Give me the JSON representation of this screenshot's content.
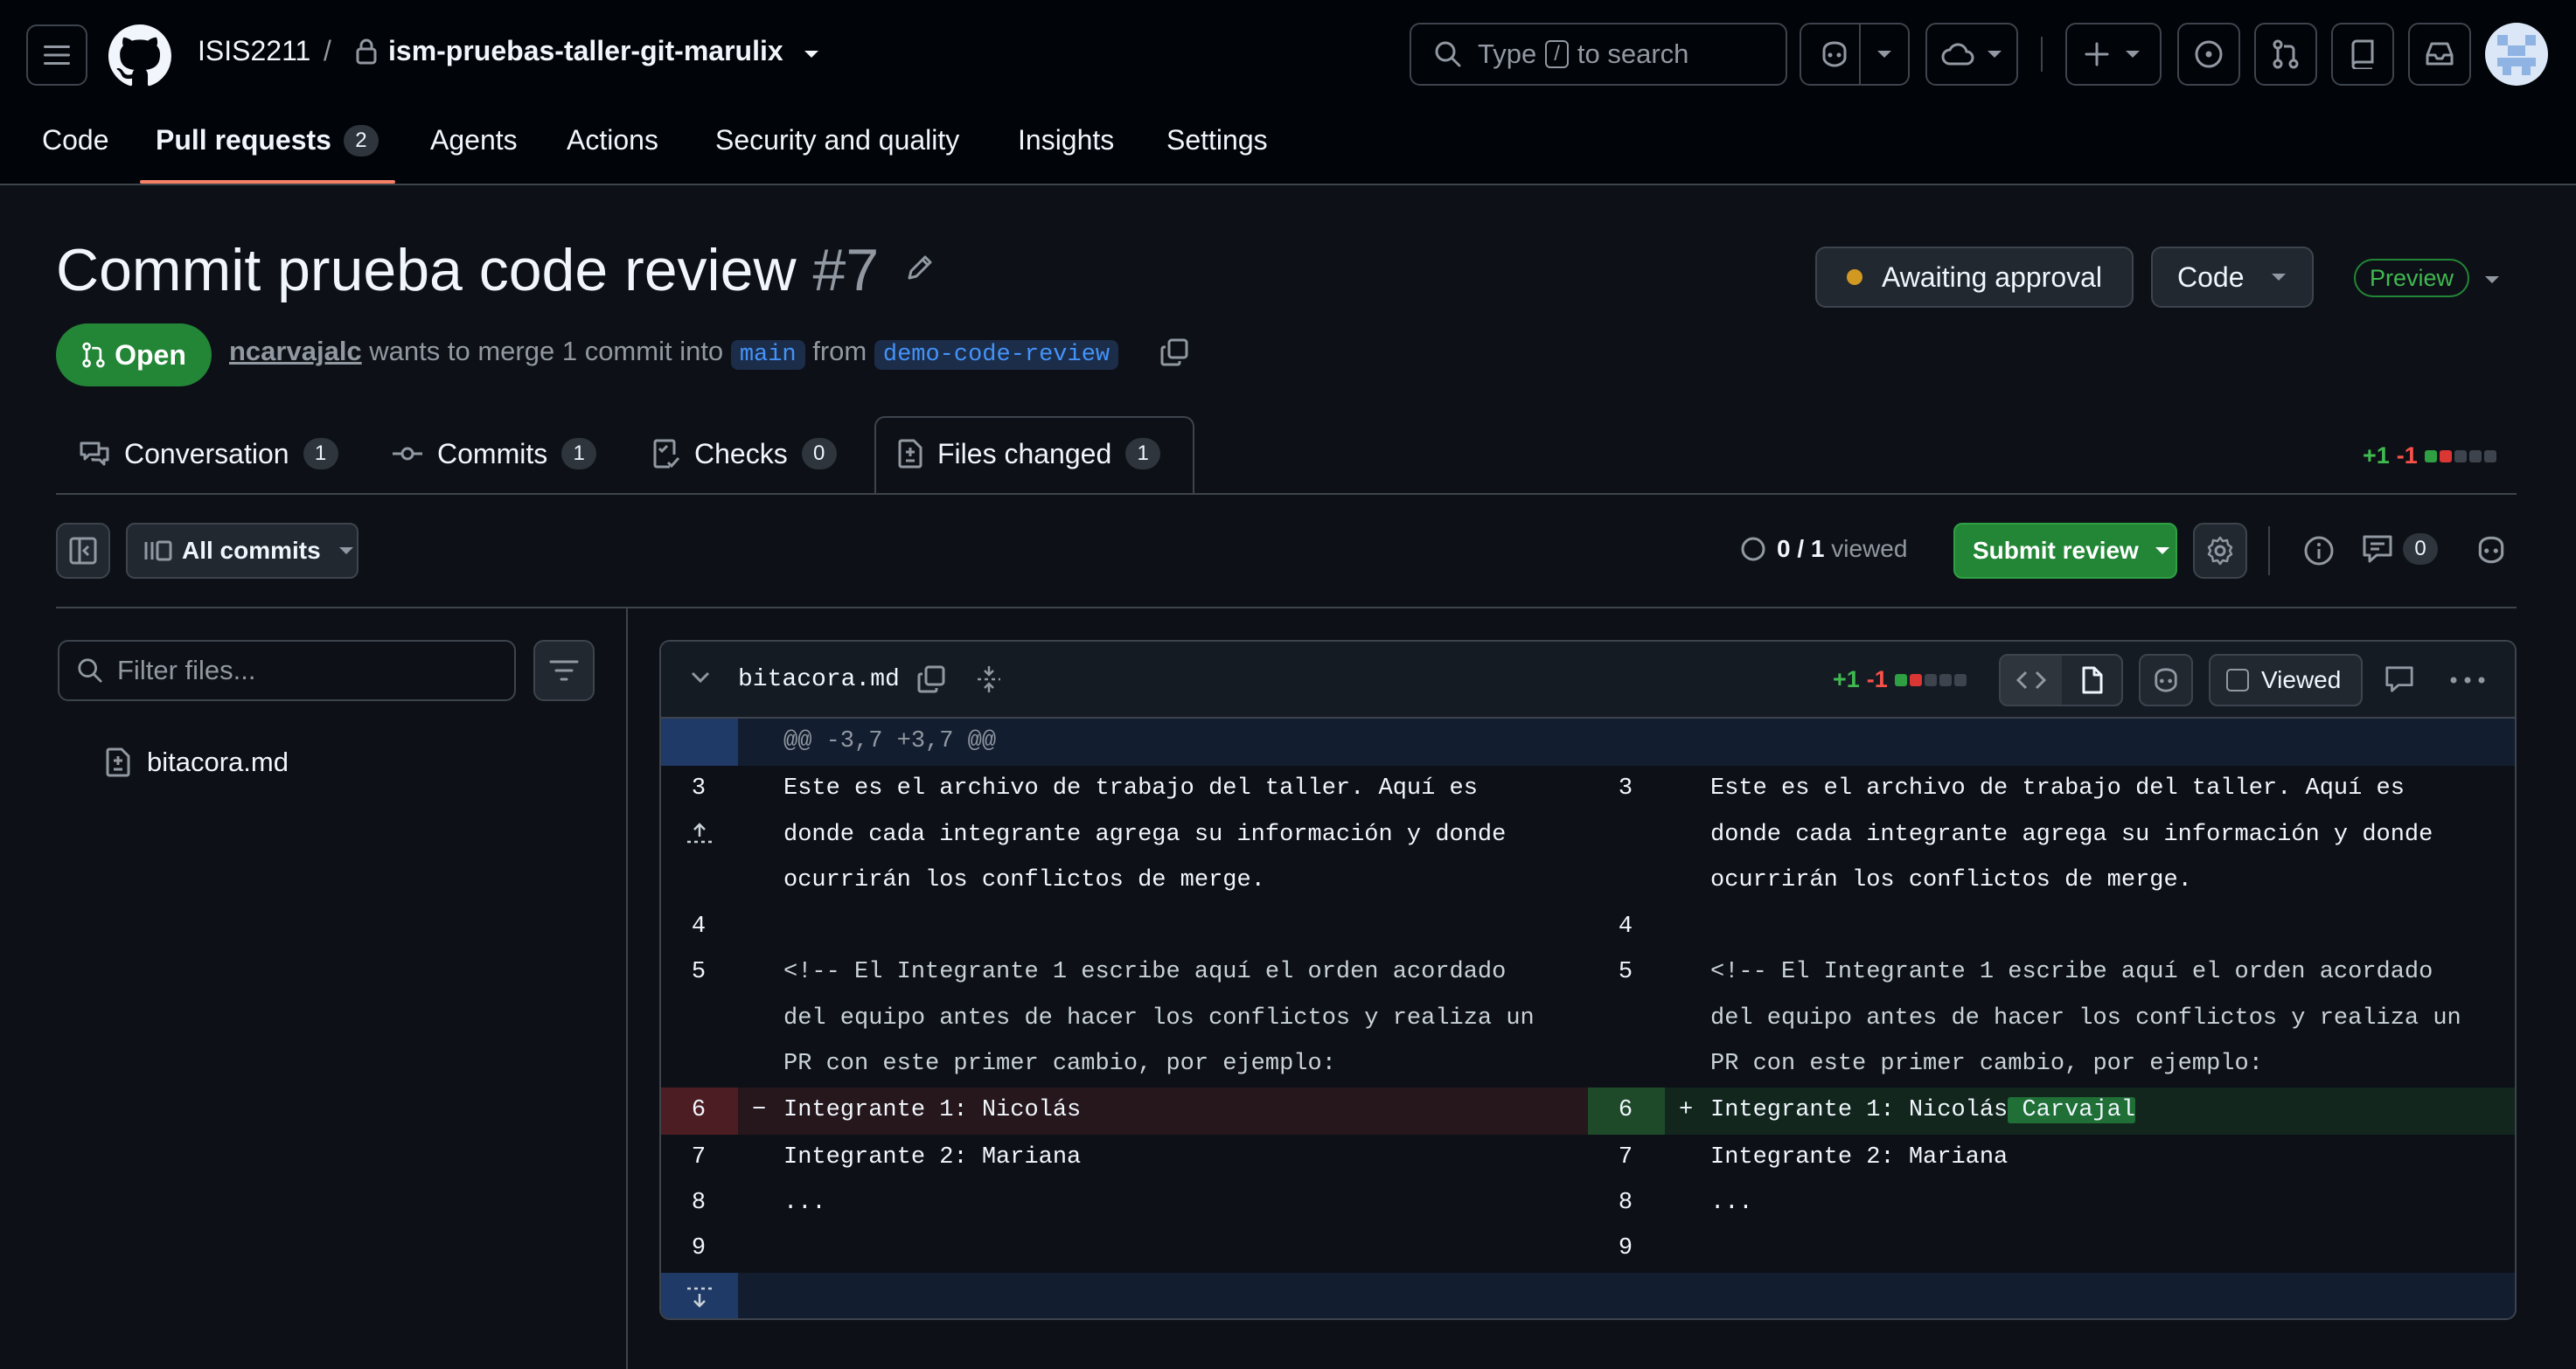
{
  "header": {
    "repo_owner": "ISIS2211",
    "repo_sep": "/",
    "repo_name": "ism-pruebas-taller-git-marulix",
    "search": {
      "prefix": "Type",
      "key": "/",
      "suffix": "to search"
    },
    "nav": [
      {
        "label": "Code"
      },
      {
        "label": "Pull requests",
        "count": "2",
        "active": true
      },
      {
        "label": "Agents"
      },
      {
        "label": "Actions"
      },
      {
        "label": "Security and quality"
      },
      {
        "label": "Insights"
      },
      {
        "label": "Settings"
      }
    ]
  },
  "pr": {
    "title": "Commit prueba code review",
    "number": "#7",
    "state": "Open",
    "author": "ncarvajalc",
    "merge_text": "wants to merge 1 commit into",
    "base_branch": "main",
    "from_text": "from",
    "head_branch": "demo-code-review",
    "awaiting_label": "Awaiting approval",
    "code_label": "Code",
    "preview_label": "Preview"
  },
  "tabs": [
    {
      "label": "Conversation",
      "count": "1"
    },
    {
      "label": "Commits",
      "count": "1"
    },
    {
      "label": "Checks",
      "count": "0"
    },
    {
      "label": "Files changed",
      "count": "1",
      "active": true
    }
  ],
  "diffstat": {
    "additions": "+1",
    "deletions": "-1"
  },
  "toolbar": {
    "all_commits": "All commits",
    "viewed_done": "0",
    "viewed_total": "/ 1",
    "viewed_label": "viewed",
    "submit_review": "Submit review",
    "comments_count": "0"
  },
  "sidebar": {
    "filter_placeholder": "Filter files...",
    "files": [
      "bitacora.md"
    ]
  },
  "diff": {
    "file": "bitacora.md",
    "additions": "+1",
    "deletions": "-1",
    "viewed_label": "Viewed",
    "hunk_header": "@@ -3,7 +3,7 @@",
    "rows": [
      {
        "left_num": "3",
        "left_text": "Este es el archivo de trabajo del taller. Aquí es\ndonde cada integrante agrega su información y donde\nocurrirán los conflictos de merge.",
        "right_num": "3",
        "right_text": "Este es el archivo de trabajo del taller. Aquí es\ndonde cada integrante agrega su información y donde\nocurrirán los conflictos de merge."
      },
      {
        "left_num": "4",
        "left_text": "",
        "right_num": "4",
        "right_text": ""
      },
      {
        "left_num": "5",
        "left_text": "<!-- El Integrante 1 escribe aquí el orden acordado\ndel equipo antes de hacer los conflictos y realiza un\nPR con este primer cambio, por ejemplo:",
        "right_num": "5",
        "right_text": "<!-- El Integrante 1 escribe aquí el orden acordado\ndel equipo antes de hacer los conflictos y realiza un\nPR con este primer cambio, por ejemplo:"
      },
      {
        "left_num": "6",
        "left_marker": "−",
        "left_text": "Integrante 1: Nicolás",
        "right_num": "6",
        "right_marker": "+",
        "right_text": "Integrante 1: Nicolás",
        "right_added": " Carvajal"
      },
      {
        "left_num": "7",
        "left_text": "Integrante 2: Mariana",
        "right_num": "7",
        "right_text": "Integrante 2: Mariana"
      },
      {
        "left_num": "8",
        "left_text": "...",
        "right_num": "8",
        "right_text": "..."
      },
      {
        "left_num": "9",
        "left_text": "",
        "right_num": "9",
        "right_text": ""
      }
    ]
  },
  "colors": {
    "bg": "#0d1117",
    "header_bg": "#010409",
    "accent_green": "#238636",
    "link_blue": "#4493f8",
    "pending": "#d29922",
    "deletion": "#f85149",
    "addition": "#3fb950"
  }
}
